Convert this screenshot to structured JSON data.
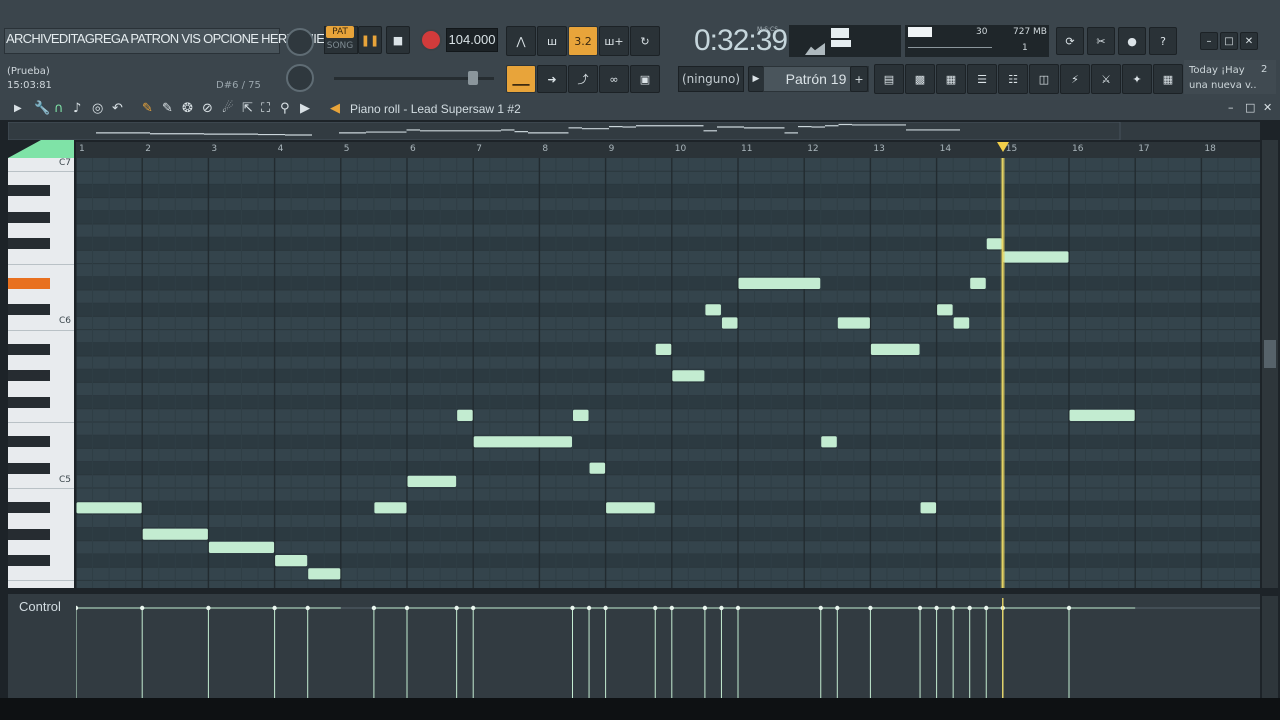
{
  "toolbar": {
    "menu": [
      "ARCHIV",
      "EDITA",
      "GREGA",
      "PATRON",
      "VIS",
      "OPCIONE",
      "HERRAMIENTA"
    ],
    "hint_line1": "(Prueba)",
    "hint_line2": "15:03:81",
    "note_info": "D#6 / 75",
    "pat_label": "PAT",
    "song_label": "SONG",
    "tempo": "104.000",
    "time_label": "M:S:CS",
    "time": "0:32:39",
    "cpu": "30",
    "memory": "727 MB",
    "polyphony": "1",
    "snap": "(ninguno)",
    "pattern": "Patrón 19",
    "news_line1": "Today  ¡Hay",
    "news_line2": "una nueva v..",
    "news_count": "2",
    "step_label": "3.2"
  },
  "piano_roll": {
    "title": "Piano roll - Lead Supersaw 1 #2",
    "bars": [
      "1",
      "2",
      "3",
      "4",
      "5",
      "6",
      "7",
      "8",
      "9",
      "10",
      "11",
      "12",
      "13",
      "14",
      "15",
      "16",
      "17",
      "18"
    ],
    "octave_labels": [
      "C7",
      "C6",
      "C5"
    ],
    "control_label": "Control",
    "playhead_beat": 15.0,
    "note_color": "#c3ecd1",
    "grid_color": "#34444c",
    "notes": [
      {
        "start": 1.0,
        "end": 2.0,
        "pitch": 70
      },
      {
        "start": 2.0,
        "end": 3.0,
        "pitch": 68
      },
      {
        "start": 3.0,
        "end": 4.0,
        "pitch": 67
      },
      {
        "start": 4.0,
        "end": 4.5,
        "pitch": 66
      },
      {
        "start": 4.5,
        "end": 5.0,
        "pitch": 65
      },
      {
        "start": 5.5,
        "end": 6.0,
        "pitch": 70
      },
      {
        "start": 6.0,
        "end": 6.75,
        "pitch": 72
      },
      {
        "start": 6.75,
        "end": 7.0,
        "pitch": 77
      },
      {
        "start": 7.0,
        "end": 8.5,
        "pitch": 75
      },
      {
        "start": 8.5,
        "end": 8.75,
        "pitch": 77
      },
      {
        "start": 8.75,
        "end": 9.0,
        "pitch": 73
      },
      {
        "start": 9.0,
        "end": 9.75,
        "pitch": 70
      },
      {
        "start": 9.75,
        "end": 10.0,
        "pitch": 82
      },
      {
        "start": 10.0,
        "end": 10.5,
        "pitch": 80
      },
      {
        "start": 10.5,
        "end": 10.75,
        "pitch": 85
      },
      {
        "start": 10.75,
        "end": 11.0,
        "pitch": 84
      },
      {
        "start": 11.0,
        "end": 12.25,
        "pitch": 87
      },
      {
        "start": 12.25,
        "end": 12.5,
        "pitch": 75
      },
      {
        "start": 12.5,
        "end": 13.0,
        "pitch": 84
      },
      {
        "start": 13.0,
        "end": 13.75,
        "pitch": 82
      },
      {
        "start": 13.75,
        "end": 14.0,
        "pitch": 70
      },
      {
        "start": 14.0,
        "end": 14.25,
        "pitch": 85
      },
      {
        "start": 14.25,
        "end": 14.5,
        "pitch": 84
      },
      {
        "start": 14.5,
        "end": 14.75,
        "pitch": 87
      },
      {
        "start": 14.75,
        "end": 15.0,
        "pitch": 90
      },
      {
        "start": 15.0,
        "end": 16.0,
        "pitch": 89
      },
      {
        "start": 16.0,
        "end": 17.0,
        "pitch": 77
      }
    ]
  }
}
